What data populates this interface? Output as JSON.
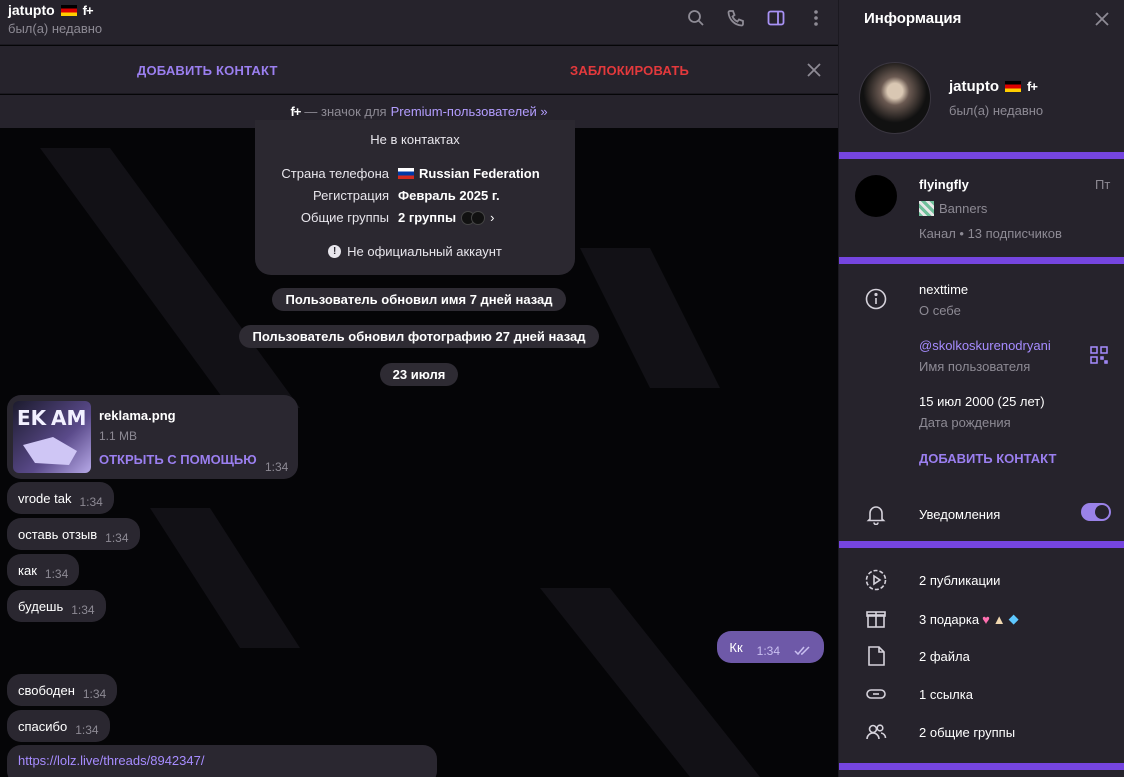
{
  "chat": {
    "peer_name": "jatupto",
    "peer_status": "был(а) недавно",
    "premium_badge": "f+",
    "actions": {
      "add_contact": "ДОБАВИТЬ КОНТАКТ",
      "block": "ЗАБЛОКИРОВАТЬ"
    },
    "premium_note": {
      "prefix": "— значок для",
      "link": "Premium-пользователей »"
    },
    "info_card": {
      "not_in_contacts": "Не в контактах",
      "phone_country_label": "Страна телефона",
      "phone_country_value": "Russian Federation",
      "registration_label": "Регистрация",
      "registration_value": "Февраль 2025 г.",
      "groups_label": "Общие группы",
      "groups_value": "2 группы",
      "unofficial": "Не официальный аккаунт"
    },
    "service": {
      "name_update": "Пользователь обновил имя 7 дней назад",
      "photo_update": "Пользователь обновил фотографию 27 дней назад",
      "date": "23 июля"
    },
    "file": {
      "name": "reklama.png",
      "size": "1.1 MB",
      "open": "ОТКРЫТЬ С ПОМОЩЬЮ",
      "time": "1:34"
    },
    "messages": [
      {
        "text": "vrode tak",
        "time": "1:34"
      },
      {
        "text": "оставь отзыв",
        "time": "1:34"
      },
      {
        "text": "как",
        "time": "1:34"
      },
      {
        "text": "будешь",
        "time": "1:34"
      },
      {
        "text": "свободен",
        "time": "1:34"
      },
      {
        "text": "спасибо",
        "time": "1:34"
      }
    ],
    "outgoing": {
      "text": "Кк",
      "time": "1:34"
    },
    "link": "https://lolz.live/threads/8942347/"
  },
  "panel": {
    "title": "Информация",
    "name": "jatupto",
    "status": "был(а) недавно",
    "channel": {
      "name": "flyingfly",
      "day": "Пт",
      "post": "Banners",
      "meta": "Канал • 13 подписчиков"
    },
    "bio": {
      "value": "nexttime",
      "label": "О себе"
    },
    "username": {
      "value": "@skolkoskurenodryani",
      "label": "Имя пользователя"
    },
    "birthday": {
      "value": "15 июл 2000 (25 лет)",
      "label": "Дата рождения"
    },
    "add_contact": "ДОБАВИТЬ КОНТАКТ",
    "notifications": "Уведомления",
    "notifications_on": true,
    "stats": {
      "posts": "2 публикации",
      "gifts": "3 подарка",
      "files": "2 файла",
      "links": "1 ссылка",
      "groups": "2 общие группы"
    }
  },
  "colors": {
    "accent": "#7545e0",
    "link": "#9b7ff0",
    "danger": "#e3393c"
  }
}
